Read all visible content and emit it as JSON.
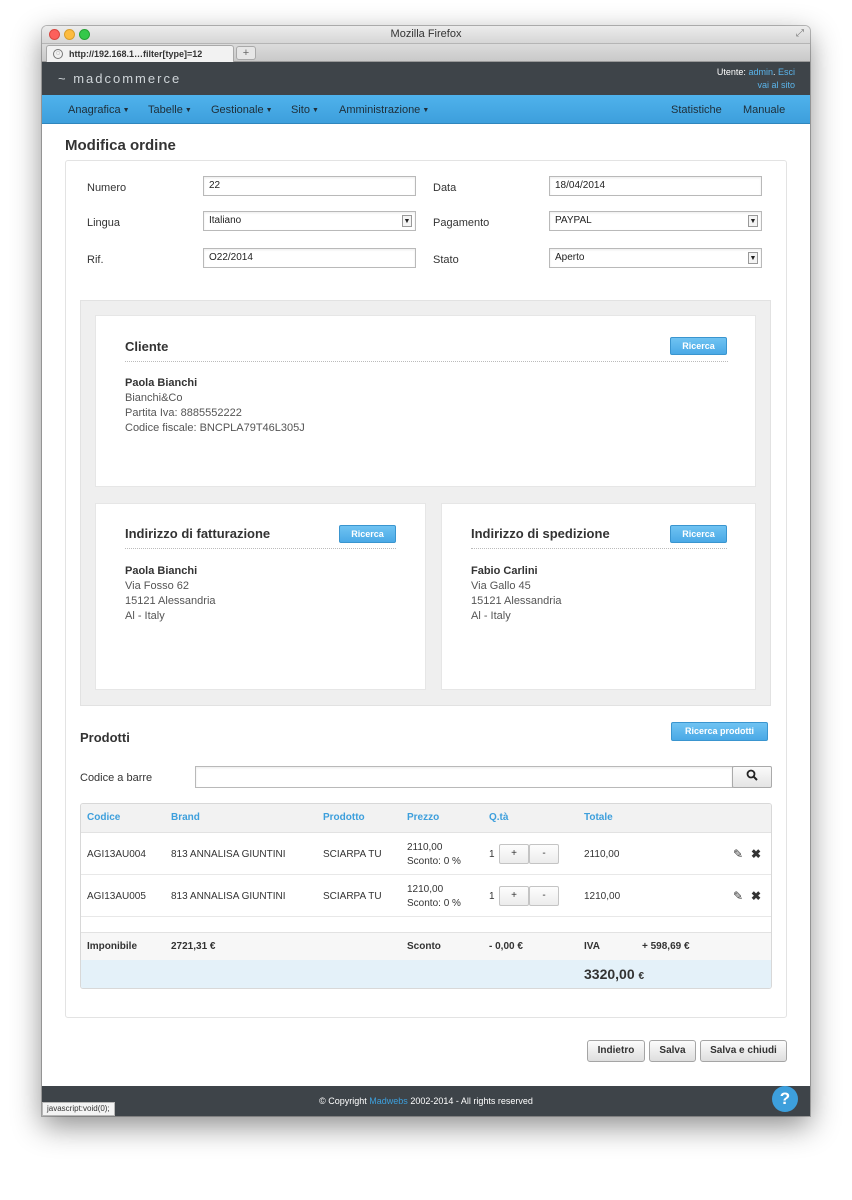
{
  "browser": {
    "window_title": "Mozilla Firefox",
    "tab_label": "http://192.168.1…filter[type]=12",
    "new_tab": "+",
    "status_text": "javascript:void(0);"
  },
  "header": {
    "logo": "~ madcommerce",
    "user_label": "Utente:",
    "user_name": "admin",
    "logout": "Esci",
    "site_link": "vai al sito"
  },
  "nav": {
    "items": [
      "Anagrafica",
      "Tabelle",
      "Gestionale",
      "Sito",
      "Amministrazione"
    ],
    "right": [
      "Statistiche",
      "Manuale"
    ]
  },
  "page": {
    "title": "Modifica ordine"
  },
  "form": {
    "numero_label": "Numero",
    "numero_value": "22",
    "data_label": "Data",
    "data_value": "18/04/2014",
    "lingua_label": "Lingua",
    "lingua_value": "Italiano",
    "pagamento_label": "Pagamento",
    "pagamento_value": "PAYPAL",
    "rif_label": "Rif.",
    "rif_value": "O22/2014",
    "stato_label": "Stato",
    "stato_value": "Aperto"
  },
  "cliente": {
    "title": "Cliente",
    "button": "Ricerca",
    "name": "Paola Bianchi",
    "company": "Bianchi&Co",
    "vat": "Partita Iva: 8885552222",
    "tax_code": "Codice fiscale: BNCPLA79T46L305J"
  },
  "fatturazione": {
    "title": "Indirizzo di fatturazione",
    "button": "Ricerca",
    "name": "Paola Bianchi",
    "street": "Via Fosso 62",
    "city": "15121 Alessandria",
    "country": "Al - Italy"
  },
  "spedizione": {
    "title": "Indirizzo di spedizione",
    "button": "Ricerca",
    "name": "Fabio Carlini",
    "street": "Via Gallo 45",
    "city": "15121 Alessandria",
    "country": "Al - Italy"
  },
  "prodotti": {
    "title": "Prodotti",
    "search_button": "Ricerca prodotti",
    "barcode_label": "Codice a barre",
    "barcode_value": "",
    "columns": [
      "Codice",
      "Brand",
      "Prodotto",
      "Prezzo",
      "Q.tà",
      "Totale"
    ],
    "rows": [
      {
        "code": "AGI13AU004",
        "brand": "813 ANNALISA GIUNTINI",
        "product": "SCIARPA TU",
        "price": "2110,00",
        "discount": "Sconto: 0 %",
        "qty": "1",
        "total": "2110,00"
      },
      {
        "code": "AGI13AU005",
        "brand": "813 ANNALISA GIUNTINI",
        "product": "SCIARPA TU",
        "price": "1210,00",
        "discount": "Sconto: 0 %",
        "qty": "1",
        "total": "1210,00"
      }
    ],
    "plus": "+",
    "minus": "-",
    "summary": {
      "imponibile_label": "Imponibile",
      "imponibile_value": "2721,31 €",
      "sconto_label": "Sconto",
      "sconto_value": "- 0,00 €",
      "iva_label": "IVA",
      "iva_value": "+ 598,69 €"
    },
    "grand_total": "3320,00",
    "currency": "€"
  },
  "actions": {
    "back": "Indietro",
    "save": "Salva",
    "save_close": "Salva e chiudi"
  },
  "footer": {
    "prefix": "© Copyright",
    "link": "Madwebs",
    "suffix": "2002-2014 - All rights reserved",
    "help": "?"
  },
  "colors": {
    "accent": "#3d9fdc",
    "header_bg": "#3e4449",
    "nav_bg": "#4aa9e6"
  }
}
